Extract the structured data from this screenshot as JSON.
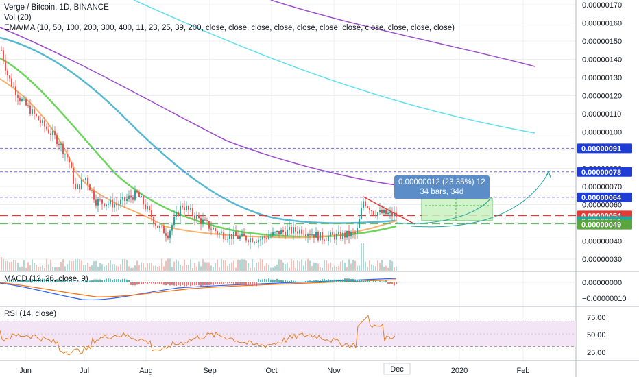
{
  "legends": {
    "main": "Verge / Bitcoin, 1D, BINANCE",
    "vol": "Vol (20)",
    "ema": "EMA/MA (10, 50, 100, 200, 300, 400, 11, 23, 25, 39, 200, close, close, close, close, close, close, close, close, close, close, close)",
    "macd": "MACD (12, 26, close, 9)",
    "rsi": "RSI (14, close)"
  },
  "colors": {
    "up": "#26a69a",
    "down": "#ef5350",
    "grid": "#eceff2",
    "axis_text": "#131722",
    "ema_orange": "#f6b26b",
    "ema_green": "#6bd45a",
    "ema_teal": "#56b8d0",
    "ema_purple": "#9b4dca",
    "ema_cyan": "#5fe0ee",
    "blue_dash": "#6c6cf0",
    "red_dash": "#e53935",
    "green_dash": "#66bb6a",
    "rsi_fill": "#f3e5f5",
    "rsi_line": "#e67e22"
  },
  "chart_data": {
    "type": "candlestick",
    "x_tick_labels": [
      "Jun",
      "Jul",
      "Aug",
      "Sep",
      "Oct",
      "Nov",
      "Dec",
      "2020",
      "Feb"
    ],
    "y_tick_labels": [
      "0.00000170",
      "0.00000160",
      "0.00000150",
      "0.00000140",
      "0.00000130",
      "0.00000120",
      "0.00000110",
      "0.00000100",
      "0.00000090",
      "0.00000080",
      "0.00000070",
      "0.00000060",
      "0.00000050",
      "0.00000040",
      "0.00000030"
    ],
    "y_range": [
      2.6e-07,
      1.73e-06
    ],
    "price_labels": [
      {
        "text": "0.00000091",
        "value": 9.1e-07,
        "color": "#1e3dd6"
      },
      {
        "text": "0.00000078",
        "value": 7.8e-07,
        "color": "#1e3dd6"
      },
      {
        "text": "0.00000064",
        "value": 6.4e-07,
        "color": "#1e3dd6"
      },
      {
        "text": "0.00000054",
        "value": 5.4e-07,
        "color": "#e53935"
      },
      {
        "text": "0.00000051",
        "value": 5.1e-07,
        "color": "#26a69a"
      },
      {
        "text": "0.00000049",
        "value": 4.9e-07,
        "color": "#5aa53d"
      }
    ],
    "measure_box": {
      "line1": "0.00000012 (23.35%) 12",
      "line2": "34 bars, 34d"
    },
    "macd": {
      "y_tick_labels": [
        "0.00000000",
        "−0.00000010"
      ]
    },
    "rsi": {
      "y_tick_labels": [
        "75.00",
        "50.00",
        "25.00"
      ],
      "upper": 70,
      "lower": 30
    }
  }
}
